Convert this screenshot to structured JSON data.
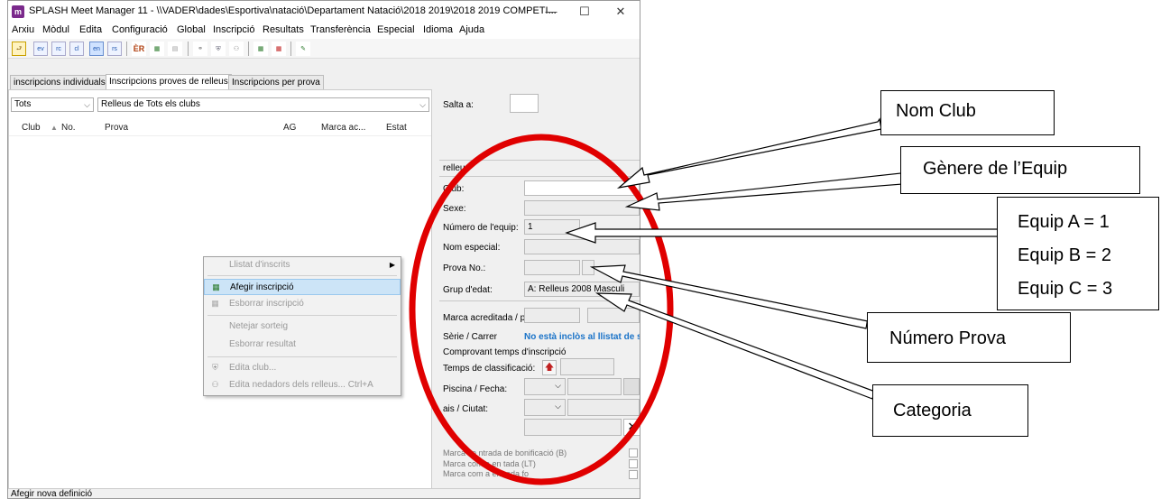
{
  "window": {
    "title": "SPLASH Meet Manager 11 - \\\\VADER\\dades\\Esportiva\\natació\\Departament Natació\\2018 2019\\2018 2019 COMPETI...",
    "app_icon_letter": "m",
    "controls": {
      "minimize": "—",
      "maximize": "☐",
      "close": "✕"
    }
  },
  "menu": [
    "Arxiu",
    "Mòdul",
    "Edita",
    "Configuració",
    "Global",
    "Inscripció",
    "Resultats",
    "Transferència",
    "Especial",
    "Idioma",
    "Ajuda"
  ],
  "toolbar": {
    "buttons": [
      "ev",
      "rc",
      "cl",
      "en",
      "rs"
    ]
  },
  "tabs": [
    "inscripcions individuals",
    "Inscripcions proves de relleus",
    "Inscripcions per prova"
  ],
  "filters": {
    "scope": "Tots",
    "relay_filter": "Relleus de Tots els clubs"
  },
  "list_columns": [
    "Club",
    "No.",
    "Prova",
    "AG",
    "Marca ac...",
    "Estat"
  ],
  "context_menu": {
    "items": [
      {
        "label": "Llistat d'inscrits",
        "enabled": false,
        "submenu": true
      },
      {
        "label": "Afegir inscripció",
        "enabled": true,
        "highlighted": true
      },
      {
        "label": "Esborrar inscripció",
        "enabled": false
      },
      {
        "label": "Netejar sorteig",
        "enabled": false
      },
      {
        "label": "Esborrar resultat",
        "enabled": false
      },
      {
        "label": "Edita club...",
        "enabled": false
      },
      {
        "label": "Edita nedadors dels relleus... Ctrl+A",
        "enabled": false
      }
    ]
  },
  "detail": {
    "salta_label": "Salta a:",
    "section_title": "relleu;",
    "club_label": "Club:",
    "sexe_label": "Sexe:",
    "team_number_label": "Número de l'equip:",
    "team_number_value": "1",
    "special_name_label": "Nom especial:",
    "prova_no_label": "Prova No.:",
    "age_group_label": "Grup d'edat:",
    "age_group_value": "A: Relleus 2008 Masculi",
    "marca_label": "Marca acreditada / pis",
    "serie_label": "Sèrie / Carrer",
    "serie_value": "No està inclòs al llistat de s",
    "proof_label": "Comprovant temps d'inscripció",
    "classification_label": "Temps de classificació:",
    "pool_label": "Piscina / Fecha:",
    "country_label": "ais / Ciutat:",
    "bonus_label": "Marca co      ntrada de bonificació (B)",
    "late_label": "Marca com a en        tada (LT)",
    "out_label": "Marca com a entrada fo"
  },
  "statusbar": "Afegir nova definició",
  "callouts": {
    "nom_club": "Nom Club",
    "genere": "Gènere de l’Equip",
    "equip_a": "Equip A = 1",
    "equip_b": "Equip B = 2",
    "equip_c": "Equip C = 3",
    "numero_prova": "Número Prova",
    "categoria": "Categoria"
  },
  "colors": {
    "annotation_red": "#e00000",
    "highlight": "#cce4f7",
    "link_blue": "#1a73c8"
  }
}
